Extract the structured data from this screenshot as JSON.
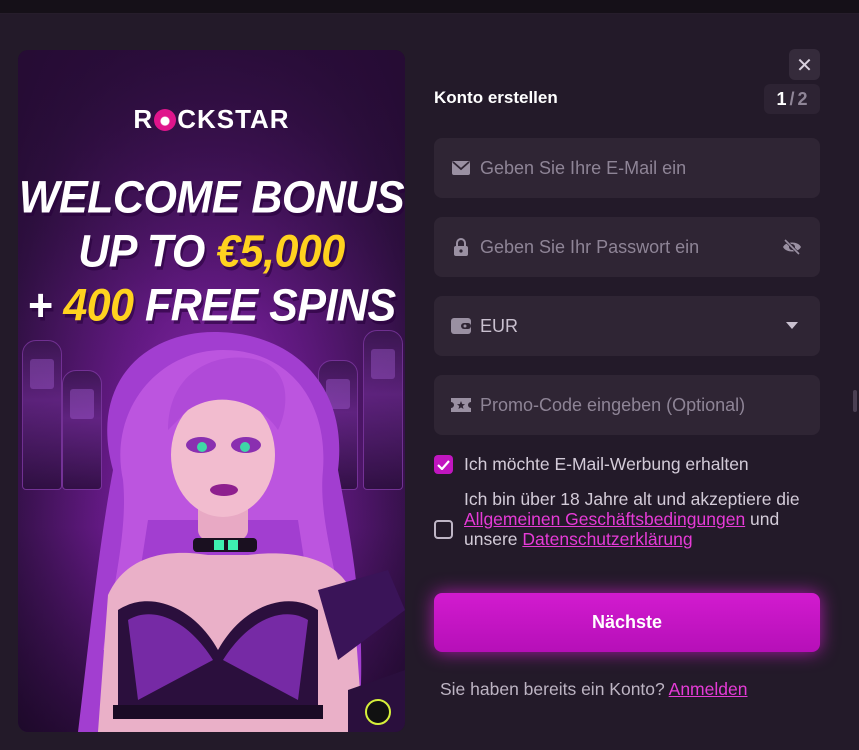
{
  "promo": {
    "logo_text_before": "R",
    "logo_text_after": "CKSTAR",
    "headline_line1": "WELCOME BONUS",
    "headline_line2_prefix": "UP TO ",
    "headline_line2_highlight": "€5,000",
    "headline_line3_prefix": "+ ",
    "headline_line3_highlight": "400",
    "headline_line3_suffix": " FREE SPINS"
  },
  "form": {
    "title": "Konto erstellen",
    "step_current": "1",
    "step_separator": "/",
    "step_total": "2",
    "close_label": "✕",
    "email_placeholder": "Geben Sie Ihre E-Mail ein",
    "password_placeholder": "Geben Sie Ihr Passwort ein",
    "currency_value": "EUR",
    "promo_placeholder": "Promo-Code eingeben (Optional)",
    "marketing_consent": {
      "label": "Ich möchte E-Mail-Werbung erhalten",
      "checked": true
    },
    "terms_consent": {
      "text_before": "Ich bin über 18 Jahre alt und akzeptiere die ",
      "link_terms": "Allgemeinen Geschäftsbedingungen",
      "text_middle": " und unsere ",
      "link_privacy": "Datenschutzerklärung",
      "checked": false
    },
    "submit_label": "Nächste",
    "login_prompt": "Sie haben bereits ein Konto?",
    "login_link": "Anmelden"
  },
  "colors": {
    "accent": "#c116c0",
    "highlight_yellow": "#ffd21f",
    "field_bg": "#2f2534",
    "modal_bg": "#231a29"
  },
  "icons": {
    "email": "envelope-icon",
    "password": "lock-icon",
    "visibility": "eye-slash-icon",
    "currency": "wallet-icon",
    "dropdown": "caret-down-icon",
    "promo": "ticket-icon",
    "close": "close-icon",
    "check": "checkmark-icon"
  }
}
